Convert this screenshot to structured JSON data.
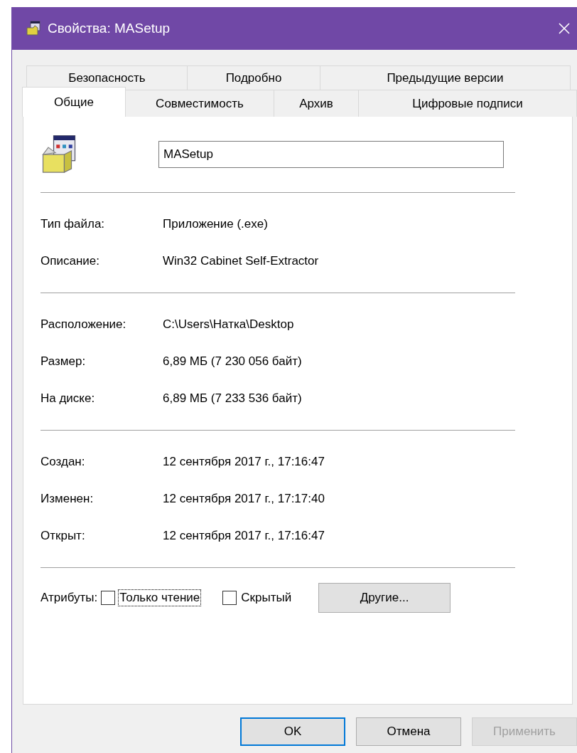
{
  "window": {
    "title": "Свойства: MASetup"
  },
  "tab_rows": [
    [
      {
        "label": "Безопасность",
        "selected": false
      },
      {
        "label": "Подробно",
        "selected": false
      },
      {
        "label": "Предыдущие версии",
        "selected": false
      }
    ],
    [
      {
        "label": "Общие",
        "selected": true
      },
      {
        "label": "Совместимость",
        "selected": false
      },
      {
        "label": "Архив",
        "selected": false
      },
      {
        "label": "Цифровые подписи",
        "selected": false
      }
    ]
  ],
  "name_field": {
    "value": "MASetup"
  },
  "groups": [
    [
      {
        "label": "Тип файла:",
        "value": "Приложение (.exe)"
      },
      {
        "label": "Описание:",
        "value": "Win32 Cabinet Self-Extractor"
      }
    ],
    [
      {
        "label": "Расположение:",
        "value": "C:\\Users\\Натка\\Desktop"
      },
      {
        "label": "Размер:",
        "value": "6,89 МБ (7 230 056 байт)"
      },
      {
        "label": "На диске:",
        "value": "6,89 МБ (7 233 536 байт)"
      }
    ],
    [
      {
        "label": "Создан:",
        "value": "12 сентября 2017 г., 17:16:47"
      },
      {
        "label": "Изменен:",
        "value": "12 сентября 2017 г., 17:17:40"
      },
      {
        "label": "Открыт:",
        "value": "12 сентября 2017 г., 17:16:47"
      }
    ]
  ],
  "attributes": {
    "label": "Атрибуты:",
    "checkboxes": [
      {
        "label": "Только чтение",
        "checked": false,
        "focused": true
      },
      {
        "label": "Скрытый",
        "checked": false,
        "focused": false
      }
    ],
    "button": "Другие..."
  },
  "buttons": [
    {
      "label": "OK",
      "default": true,
      "disabled": false
    },
    {
      "label": "Отмена",
      "default": false,
      "disabled": false
    },
    {
      "label": "Применить",
      "default": false,
      "disabled": true
    }
  ]
}
